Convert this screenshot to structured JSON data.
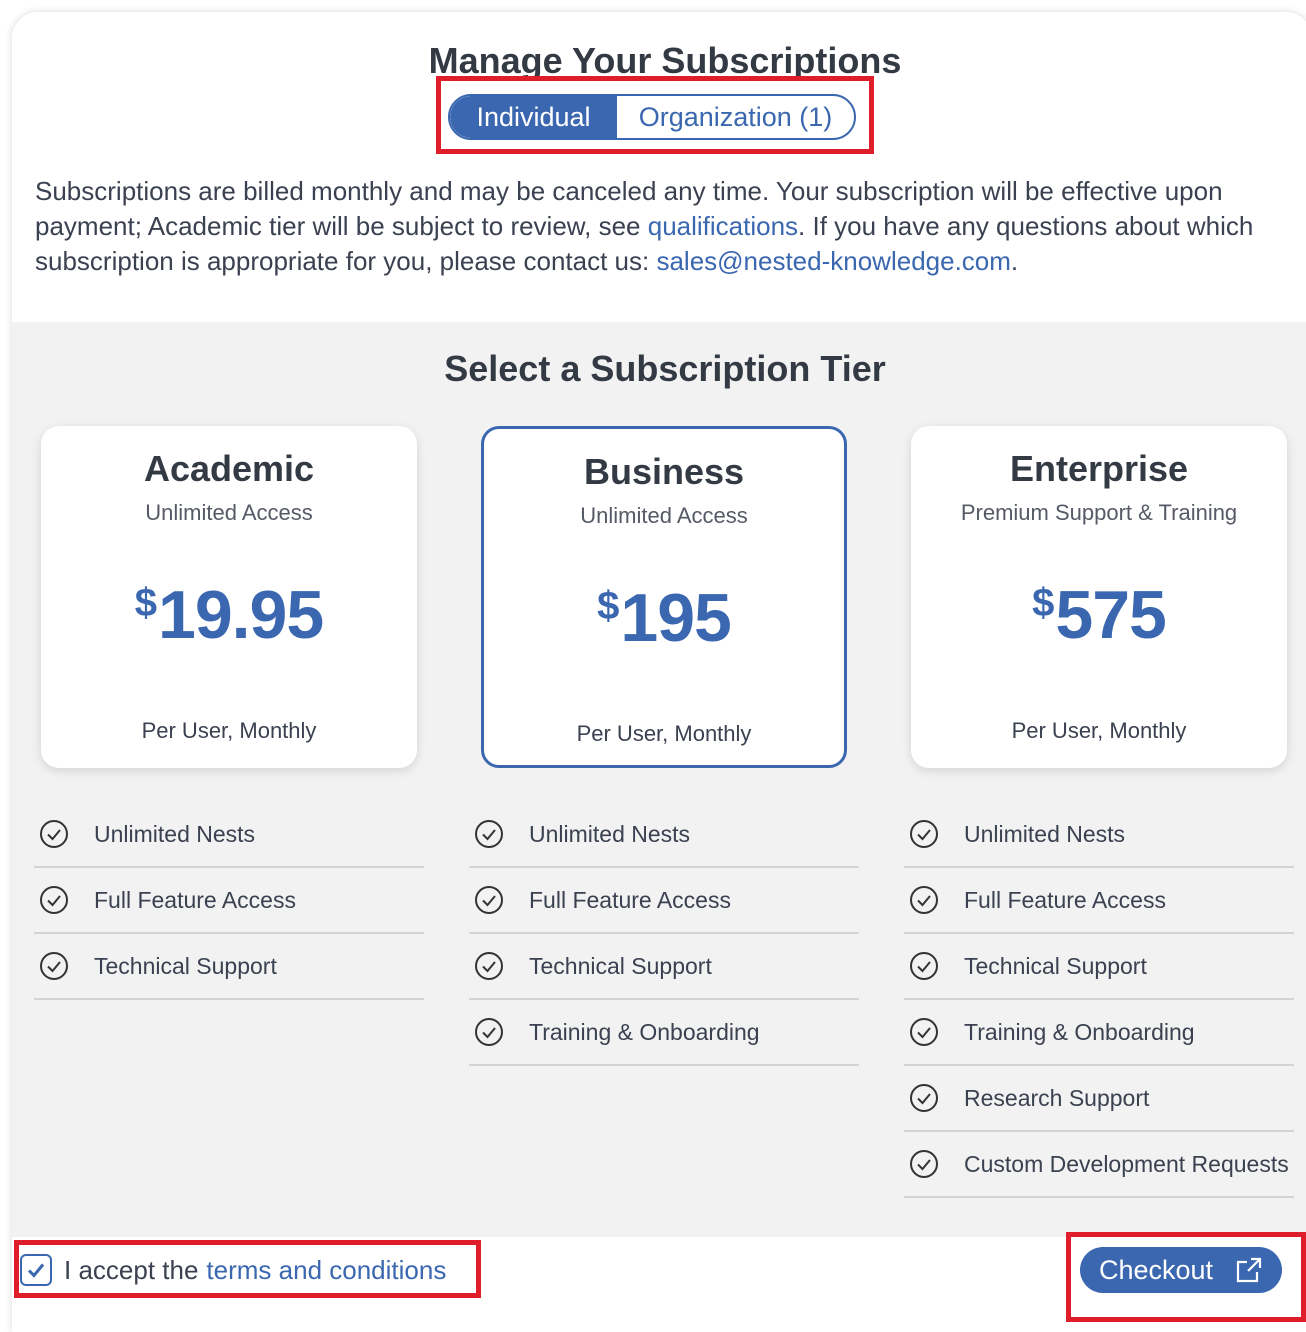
{
  "header": {
    "title": "Manage Your Subscriptions",
    "toggle": {
      "individual": "Individual",
      "organization": "Organization (1)"
    },
    "description": {
      "part1": "Subscriptions are billed monthly and may be canceled any time. Your subscription will be effective upon payment; Academic tier will be subject to review, see ",
      "link1": "qualifications",
      "part2": ". If you have any questions about which subscription is appropriate for you, please contact us: ",
      "link2": "sales@nested-knowledge.com",
      "part3": "."
    }
  },
  "tiers": {
    "title": "Select a Subscription Tier",
    "cards": [
      {
        "name": "Academic",
        "subtitle": "Unlimited Access",
        "currency": "$",
        "price": "19.95",
        "period": "Per User, Monthly",
        "features": [
          "Unlimited Nests",
          "Full Feature Access",
          "Technical Support"
        ]
      },
      {
        "name": "Business",
        "subtitle": "Unlimited Access",
        "currency": "$",
        "price": "195",
        "period": "Per User, Monthly",
        "features": [
          "Unlimited Nests",
          "Full Feature Access",
          "Technical Support",
          "Training & Onboarding"
        ]
      },
      {
        "name": "Enterprise",
        "subtitle": "Premium Support & Training",
        "currency": "$",
        "price": "575",
        "period": "Per User, Monthly",
        "features": [
          "Unlimited Nests",
          "Full Feature Access",
          "Technical Support",
          "Training & Onboarding",
          "Research Support",
          "Custom Development Requests"
        ]
      }
    ]
  },
  "footer": {
    "accept_text": "I accept the",
    "terms_link": "terms and conditions",
    "checkout_label": "Checkout"
  },
  "colors": {
    "accent": "#3a67b0",
    "highlight": "#e01e2b",
    "text": "#3b4150"
  }
}
